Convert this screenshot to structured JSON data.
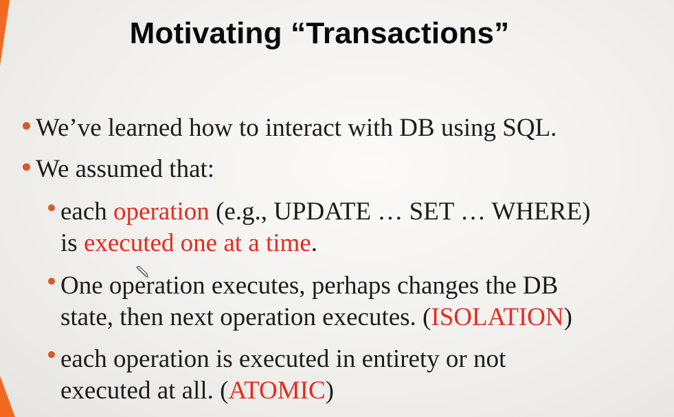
{
  "slide": {
    "title": "Motivating “Transactions”",
    "bullets": {
      "b1": "We’ve learned how to interact with DB using SQL.",
      "b2": "We assumed that:",
      "b3": {
        "p1": "each ",
        "red1": "operation",
        "p2": " (e.g., UPDATE … SET … WHERE)",
        "p3": "is ",
        "red2": "executed one at a time",
        "p4": "."
      },
      "b4": {
        "p1": "One operation executes, perhaps changes the DB",
        "p2": "state, then next operation executes. (",
        "red1": "ISOLATION",
        "p3": ")"
      },
      "b5": {
        "p1": "each operation is executed in entirety or not",
        "p2": "executed at all. (",
        "red1": "ATOMIC",
        "p3": ")"
      }
    }
  },
  "colors": {
    "accent": "#f26a21",
    "bullet": "#d65a2a",
    "highlight": "#e32b1f",
    "text": "#1c1c1c"
  },
  "icons": {
    "cursor": "pen-cursor-icon"
  }
}
